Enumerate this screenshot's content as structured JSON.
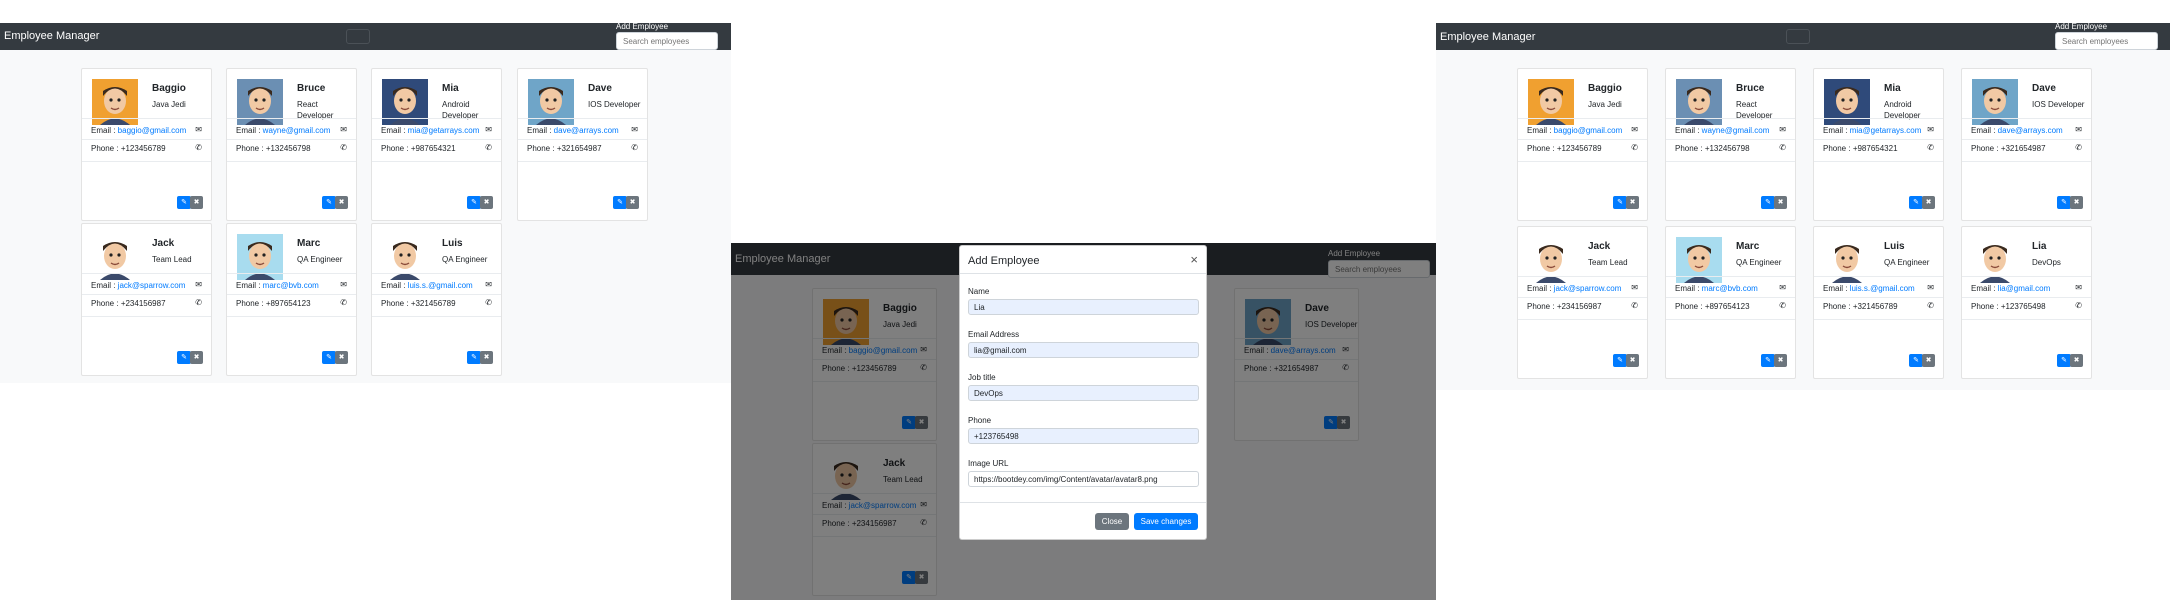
{
  "app": {
    "brand": "Employee Manager",
    "add_link": "Add Employee",
    "search_placeholder": "Search employees"
  },
  "icons": {
    "email": "envelope-icon",
    "phone": "phone-icon",
    "edit": "pencil-icon",
    "delete": "x-icon"
  },
  "colors": {
    "navbar": "#343a40",
    "link": "#007bff",
    "edit_button": "#007bff",
    "delete_button": "#6c757d"
  },
  "employees": [
    {
      "name": "Baggio",
      "job": "Java Jedi",
      "email": "baggio@gmail.com",
      "phone": "+123456789"
    },
    {
      "name": "Bruce",
      "job": "React Developer",
      "email": "wayne@gmail.com",
      "phone": "+132456798"
    },
    {
      "name": "Mia",
      "job": "Android Developer",
      "email": "mia@getarrays.com",
      "phone": "+987654321"
    },
    {
      "name": "Dave",
      "job": "IOS Developer",
      "email": "dave@arrays.com",
      "phone": "+321654987"
    },
    {
      "name": "Jack",
      "job": "Team Lead",
      "email": "jack@sparrow.com",
      "phone": "+234156987"
    },
    {
      "name": "Marc",
      "job": "QA Engineer",
      "email": "marc@bvb.com",
      "phone": "+897654123"
    },
    {
      "name": "Luis",
      "job": "QA Engineer",
      "email": "luis.s.@gmail.com",
      "phone": "+321456789"
    },
    {
      "name": "Lia",
      "job": "DevOps",
      "email": "lia@gmail.com",
      "phone": "+123765498"
    }
  ],
  "labels": {
    "email": "Email : ",
    "phone": "Phone : "
  },
  "modal": {
    "title": "Add Employee",
    "close_x": "×",
    "name_label": "Name",
    "name_value": "Lia",
    "email_label": "Email Address",
    "email_value": "lia@gmail.com",
    "job_label": "Job title",
    "job_value": "DevOps",
    "phone_label": "Phone",
    "phone_value": "+123765498",
    "image_label": "Image URL",
    "image_value": "https://bootdey.com/img/Content/avatar/avatar8.png",
    "close_button": "Close",
    "save_button": "Save changes"
  }
}
